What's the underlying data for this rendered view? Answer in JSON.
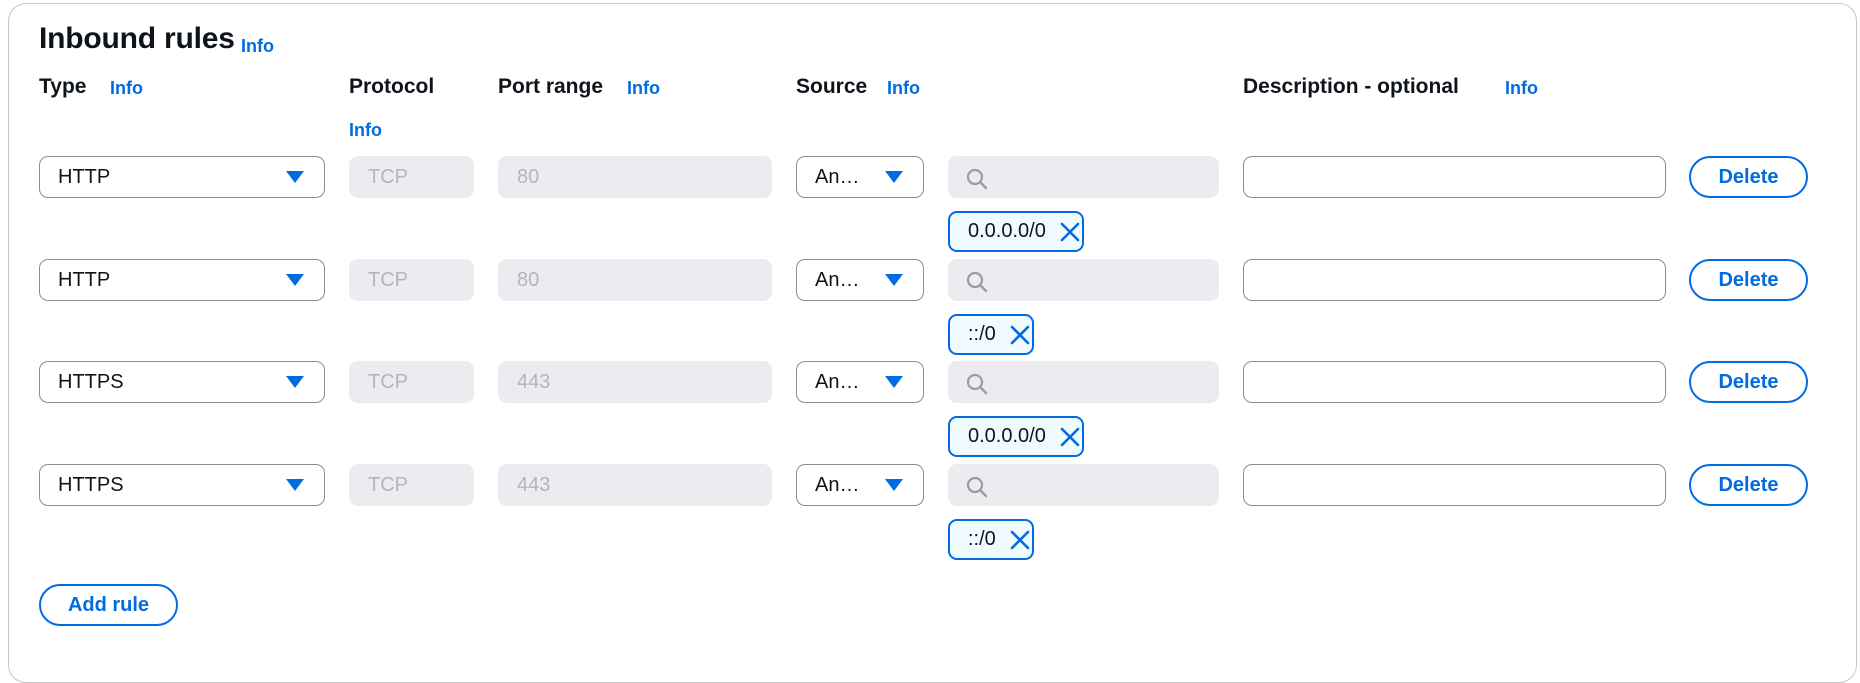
{
  "section": {
    "title": "Inbound rules",
    "info_label": "Info"
  },
  "columns": {
    "type": "Type",
    "protocol": "Protocol",
    "port_range": "Port range",
    "source": "Source",
    "description": "Description - optional",
    "info_label": "Info"
  },
  "rules": [
    {
      "type": "HTTP",
      "protocol": "TCP",
      "port_range": "80",
      "source_type": "An…",
      "search_placeholder": "",
      "cidr": "0.0.0.0/0",
      "description": "",
      "delete_label": "Delete"
    },
    {
      "type": "HTTP",
      "protocol": "TCP",
      "port_range": "80",
      "source_type": "An…",
      "search_placeholder": "",
      "cidr": "::/0",
      "description": "",
      "delete_label": "Delete"
    },
    {
      "type": "HTTPS",
      "protocol": "TCP",
      "port_range": "443",
      "source_type": "An…",
      "search_placeholder": "",
      "cidr": "0.0.0.0/0",
      "description": "",
      "delete_label": "Delete"
    },
    {
      "type": "HTTPS",
      "protocol": "TCP",
      "port_range": "443",
      "source_type": "An…",
      "search_placeholder": "",
      "cidr": "::/0",
      "description": "",
      "delete_label": "Delete"
    }
  ],
  "add_rule_label": "Add rule",
  "icons": {
    "search": "search-icon",
    "remove": "close-icon",
    "dropdown": "caret-down-icon"
  },
  "colors": {
    "accent": "#006ce0",
    "text": "#0f141a",
    "disabled_bg": "#ebebf0",
    "disabled_text": "#b4b4bb",
    "border": "#8c8c94"
  }
}
